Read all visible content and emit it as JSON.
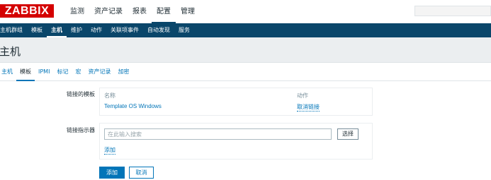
{
  "brand": {
    "logo_text": "ZABBIX",
    "color": "#d40000"
  },
  "main_menu": [
    {
      "label": "监测"
    },
    {
      "label": "资产记录"
    },
    {
      "label": "报表"
    },
    {
      "label": "配置",
      "active": true
    },
    {
      "label": "管理"
    }
  ],
  "sub_menu": [
    {
      "label": "主机群组"
    },
    {
      "label": "模板"
    },
    {
      "label": "主机",
      "active": true
    },
    {
      "label": "维护"
    },
    {
      "label": "动作"
    },
    {
      "label": "关联项事件"
    },
    {
      "label": "自动发现"
    },
    {
      "label": "服务"
    }
  ],
  "page": {
    "title": "主机"
  },
  "tabs": [
    {
      "label": "主机"
    },
    {
      "label": "模板",
      "active": true
    },
    {
      "label": "IPMI"
    },
    {
      "label": "标记"
    },
    {
      "label": "宏"
    },
    {
      "label": "资产记录"
    },
    {
      "label": "加密"
    }
  ],
  "linked_templates": {
    "label": "链接的模板",
    "columns": {
      "name": "名称",
      "action": "动作"
    },
    "rows": [
      {
        "name": "Template OS Windows",
        "action": "取消链接"
      }
    ]
  },
  "link_indicator": {
    "label": "链接指示器",
    "search_placeholder": "在此输入搜索",
    "select_label": "选择",
    "add_label": "添加"
  },
  "form_actions": {
    "add_label": "添加",
    "cancel_label": "取消"
  },
  "colors": {
    "nav_dark": "#0a466a",
    "link": "#0275b8",
    "header_bg": "#ebeef0"
  }
}
